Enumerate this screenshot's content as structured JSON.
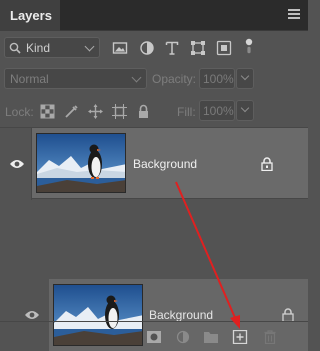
{
  "panel": {
    "tab_label": "Layers"
  },
  "filter": {
    "kind_label": "Kind",
    "icons": [
      "image-filter-icon",
      "adjustment-filter-icon",
      "type-filter-icon",
      "shape-filter-icon",
      "smart-object-filter-icon",
      "filter-toggle-icon"
    ]
  },
  "blend": {
    "mode": "Normal",
    "opacity_label": "Opacity:",
    "opacity_value": "100%"
  },
  "lock": {
    "label": "Lock:",
    "fill_label": "Fill:",
    "fill_value": "100%"
  },
  "layers": [
    {
      "name": "Background",
      "visible": true,
      "locked": true,
      "selected": true
    }
  ],
  "drag_preview": {
    "name": "Background"
  },
  "bottom_icons": [
    "add-mask-icon",
    "adjustment-layer-icon",
    "group-folder-icon",
    "new-layer-icon",
    "delete-icon"
  ],
  "colors": {
    "panel_bg": "#535353",
    "selected_row": "#6a6a6a",
    "annotation_arrow": "#e02020"
  }
}
